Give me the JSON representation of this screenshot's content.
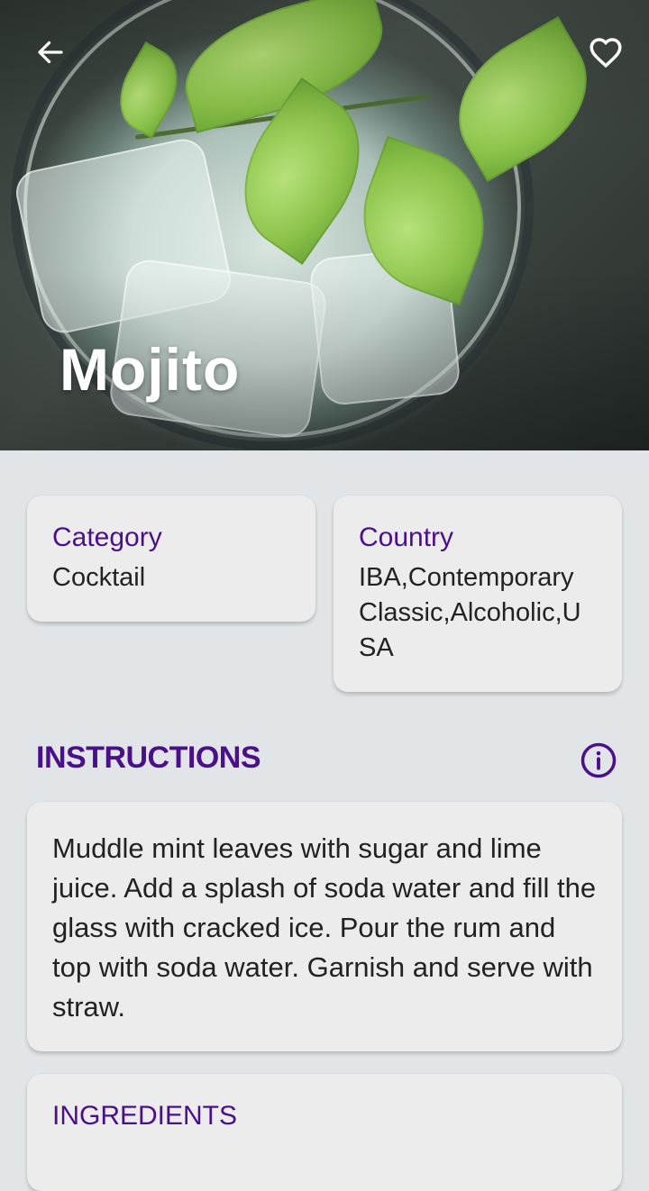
{
  "hero": {
    "title": "Mojito",
    "back_icon": "arrow-left-icon",
    "favorite_icon": "heart-outline-icon"
  },
  "info_cards": [
    {
      "label": "Category",
      "value": "Cocktail"
    },
    {
      "label": "Country",
      "value": "IBA,Contemporary Classic,Alcoholic,USA"
    }
  ],
  "instructions": {
    "title": "INSTRUCTIONS",
    "info_icon": "info-circle-icon",
    "text": "Muddle mint leaves with sugar and lime juice. Add a splash of soda water and fill the glass with cracked ice. Pour the rum and top with soda water. Garnish and serve with straw."
  },
  "ingredients": {
    "title": "INGREDIENTS"
  },
  "colors": {
    "accent": "#4b0f8c",
    "background": "#e2e5e8",
    "card": "#ececec"
  }
}
